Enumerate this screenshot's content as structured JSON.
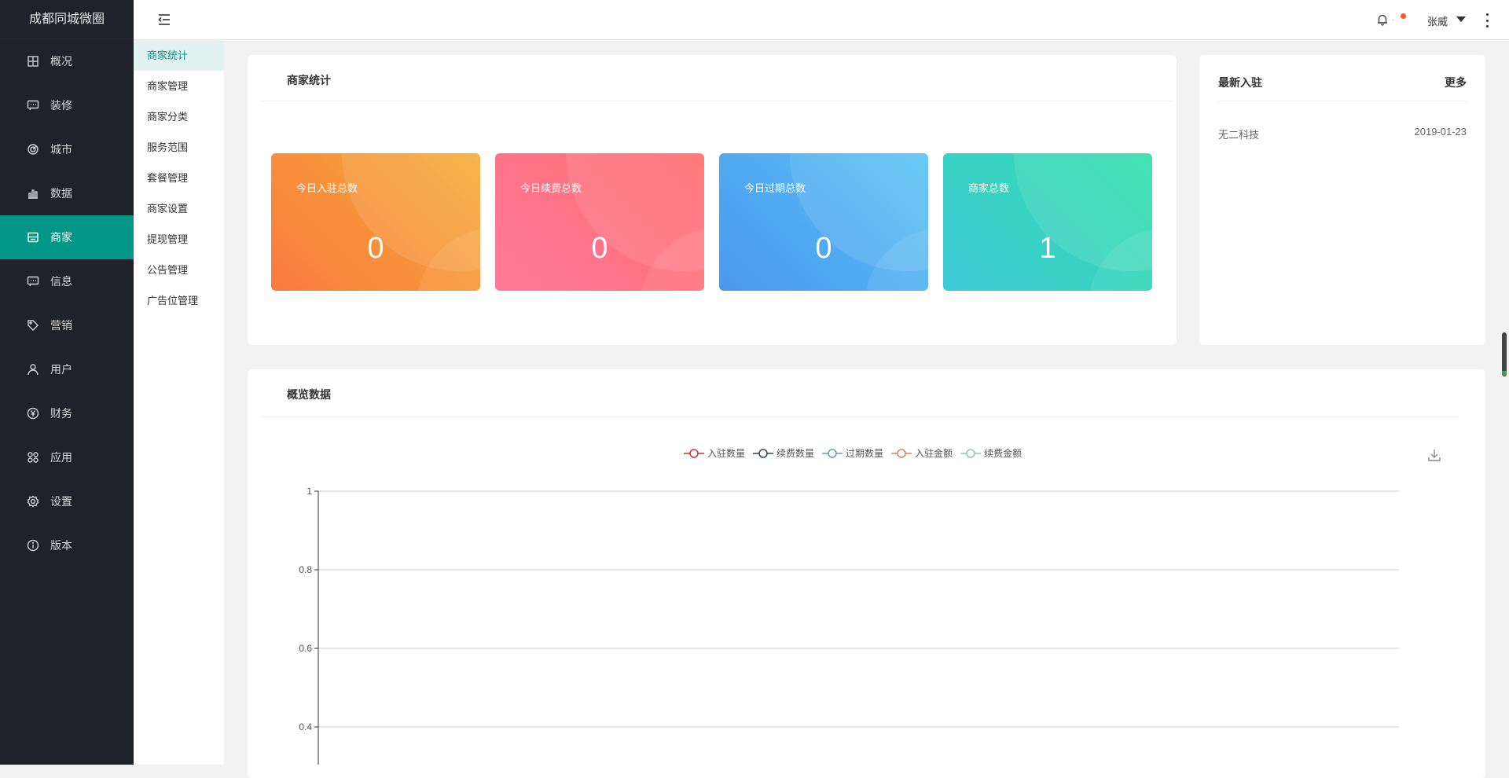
{
  "brand": "成都同城微圈",
  "sidebar": {
    "items": [
      {
        "label": "概况",
        "icon": "overview-icon"
      },
      {
        "label": "装修",
        "icon": "decorate-icon"
      },
      {
        "label": "城市",
        "icon": "city-icon"
      },
      {
        "label": "数据",
        "icon": "data-icon"
      },
      {
        "label": "商家",
        "icon": "merchant-icon"
      },
      {
        "label": "信息",
        "icon": "message-icon"
      },
      {
        "label": "营销",
        "icon": "tag-icon"
      },
      {
        "label": "用户",
        "icon": "user-icon"
      },
      {
        "label": "财务",
        "icon": "yen-icon"
      },
      {
        "label": "应用",
        "icon": "apps-icon"
      },
      {
        "label": "设置",
        "icon": "settings-icon"
      },
      {
        "label": "版本",
        "icon": "info-icon"
      }
    ],
    "active_index": 4
  },
  "submenu": {
    "items": [
      "商家统计",
      "商家管理",
      "商家分类",
      "服务范围",
      "套餐管理",
      "商家设置",
      "提现管理",
      "公告管理",
      "广告位管理"
    ],
    "active_index": 0
  },
  "header": {
    "user_name": "张威",
    "notification_dot_color": "#ff5722"
  },
  "stats_card": {
    "title": "商家统计",
    "items": [
      {
        "label": "今日入驻总数",
        "value": "0",
        "color_from": "#f97a3f",
        "color_to": "#f5ad35"
      },
      {
        "label": "今日续费总数",
        "value": "0",
        "color_from": "#ff7a9a",
        "color_to": "#ff6b6b"
      },
      {
        "label": "今日过期总数",
        "value": "0",
        "color_from": "#4a98ef",
        "color_to": "#5bc3f3"
      },
      {
        "label": "商家总数",
        "value": "1",
        "color_from": "#3fc8d8",
        "color_to": "#2fdea8"
      }
    ]
  },
  "recent_card": {
    "title": "最新入驻",
    "more": "更多",
    "rows": [
      {
        "name": "无二科技",
        "date": "2019-01-23"
      }
    ]
  },
  "overview_card": {
    "title": "概览数据"
  },
  "chart_data": {
    "type": "line",
    "series": [
      {
        "name": "入驻数量",
        "color": "#c23531",
        "values": []
      },
      {
        "name": "续费数量",
        "color": "#2f4554",
        "values": []
      },
      {
        "name": "过期数量",
        "color": "#61a0a8",
        "values": []
      },
      {
        "name": "入驻金额",
        "color": "#d48265",
        "values": []
      },
      {
        "name": "续费金额",
        "color": "#91c7ae",
        "values": []
      }
    ],
    "y_ticks": [
      "1",
      "0.8",
      "0.6",
      "0.4"
    ],
    "ylim": [
      0,
      1
    ],
    "grid": true,
    "legend_position": "top-center"
  }
}
